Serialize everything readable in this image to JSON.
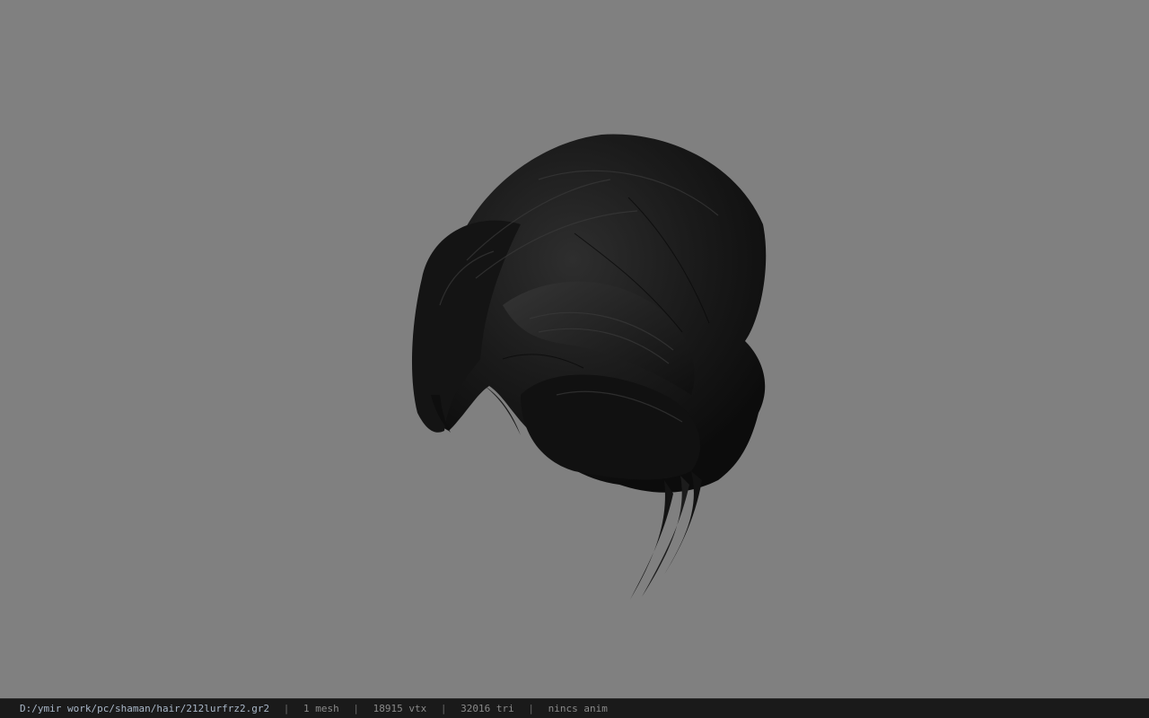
{
  "viewport": {
    "background_color": "#808080",
    "model_name": "hair-mesh"
  },
  "status": {
    "path": "D:/ymir work/pc/shaman/hair/212lurfrz2.gr2",
    "mesh": "1 mesh",
    "vertices": "18915 vtx",
    "triangles": "32016 tri",
    "anim": "nincs anim",
    "separator": "|"
  },
  "colors": {
    "statusbar_bg": "#1a1a1a",
    "path_text": "#a9b7c8",
    "info_text": "#8a8a8a",
    "hair": "#161616"
  }
}
